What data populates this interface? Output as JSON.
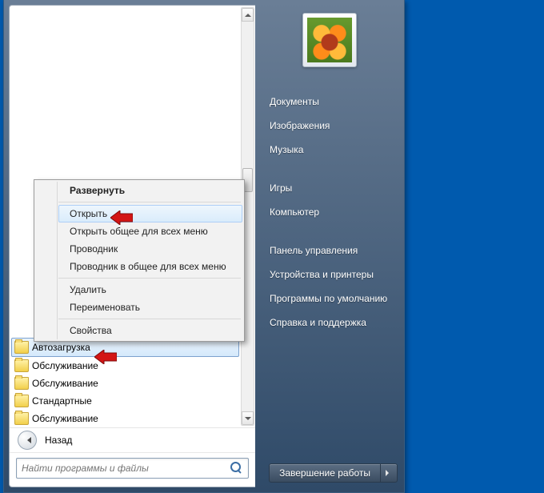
{
  "rightLinks": {
    "documents": "Документы",
    "pictures": "Изображения",
    "music": "Музыка",
    "games": "Игры",
    "computer": "Компьютер",
    "controlPanel": "Панель управления",
    "devices": "Устройства и принтеры",
    "defaultPrograms": "Программы по умолчанию",
    "help": "Справка и поддержка"
  },
  "folders": {
    "item0": "Автозагрузка",
    "item1": "Обслуживание",
    "item2": "Обслуживание",
    "item3": "Стандартные",
    "item4": "Обслуживание"
  },
  "back": {
    "label": "Назад"
  },
  "search": {
    "placeholder": "Найти программы и файлы"
  },
  "shutdown": {
    "label": "Завершение работы"
  },
  "context": {
    "expand": "Развернуть",
    "open": "Открыть",
    "openAll": "Открыть общее для всех меню",
    "explorer": "Проводник",
    "explorerAll": "Проводник в общее для всех меню",
    "delete": "Удалить",
    "rename": "Переименовать",
    "properties": "Свойства"
  }
}
